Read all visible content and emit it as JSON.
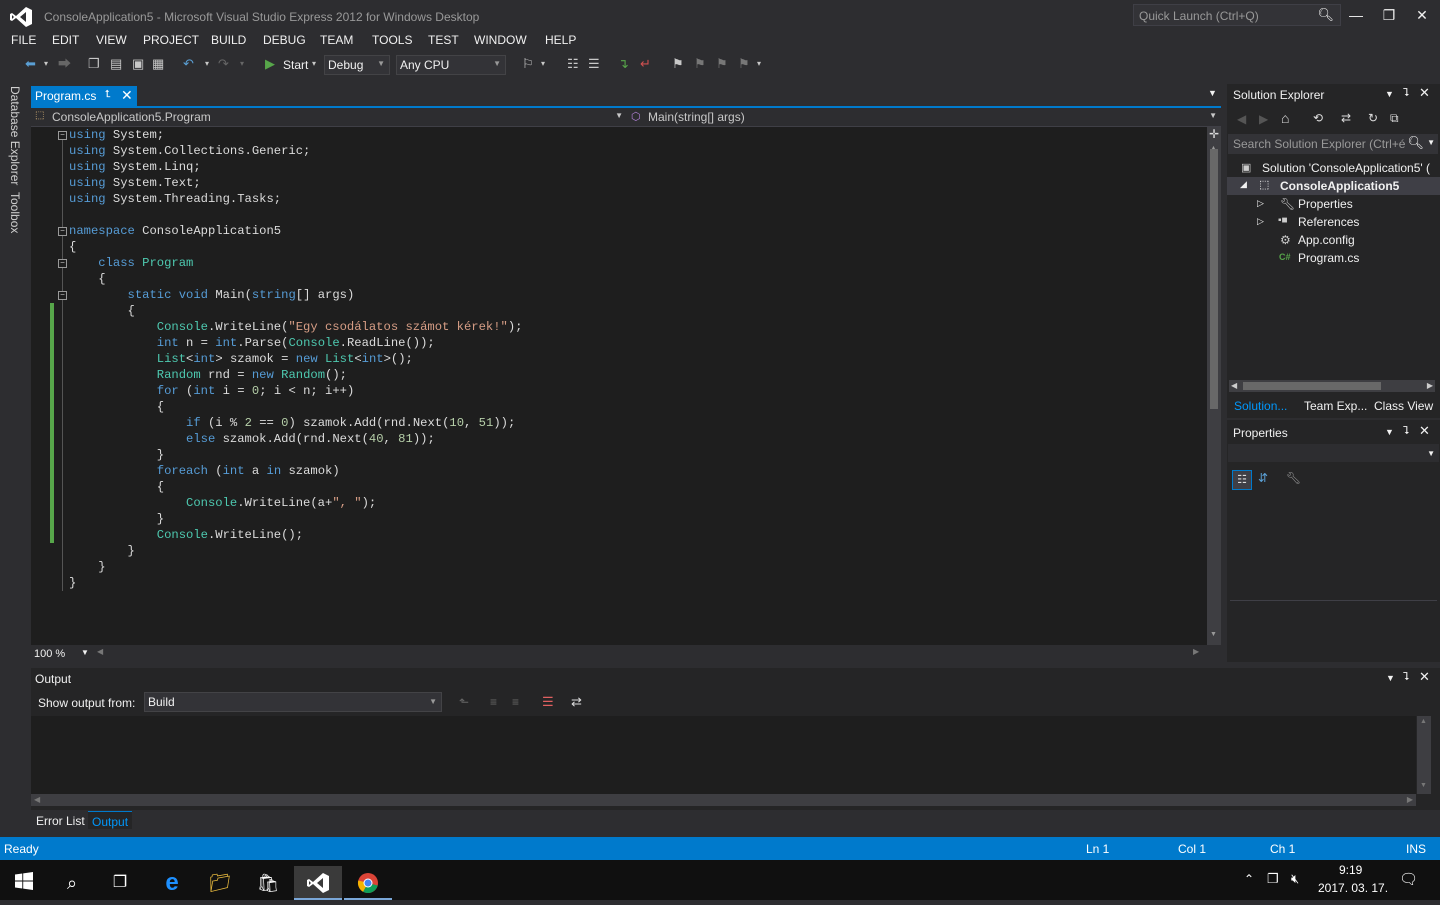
{
  "window": {
    "title": "ConsoleApplication5 - Microsoft Visual Studio Express 2012 for Windows Desktop",
    "quick_launch_placeholder": "Quick Launch (Ctrl+Q)"
  },
  "menu": [
    "FILE",
    "EDIT",
    "VIEW",
    "PROJECT",
    "BUILD",
    "DEBUG",
    "TEAM",
    "TOOLS",
    "TEST",
    "WINDOW",
    "HELP"
  ],
  "toolbar": {
    "start_label": "Start",
    "configuration": "Debug",
    "platform": "Any CPU"
  },
  "left_strip": [
    "Database Explorer",
    "Toolbox"
  ],
  "document": {
    "tab_label": "Program.cs",
    "nav_type": "ConsoleApplication5.Program",
    "nav_member": "Main(string[] args)"
  },
  "code_lines": [
    "using System;",
    "using System.Collections.Generic;",
    "using System.Linq;",
    "using System.Text;",
    "using System.Threading.Tasks;",
    "",
    "namespace ConsoleApplication5",
    "{",
    "    class Program",
    "    {",
    "        static void Main(string[] args)",
    "        {",
    "            Console.WriteLine(\"Egy csodálatos számot kérek!\");",
    "            int n = int.Parse(Console.ReadLine());",
    "            List<int> szamok = new List<int>();",
    "            Random rnd = new Random();",
    "            for (int i = 0; i < n; i++)",
    "            {",
    "                if (i % 2 == 0) szamok.Add(rnd.Next(10, 51));",
    "                else szamok.Add(rnd.Next(40, 81));",
    "            }",
    "            foreach (int a in szamok)",
    "            {",
    "                Console.WriteLine(a+\", \");",
    "            }",
    "            Console.WriteLine();",
    "        }",
    "    }",
    "}"
  ],
  "editor": {
    "zoom": "100 %"
  },
  "solution_explorer": {
    "title": "Solution Explorer",
    "search_placeholder": "Search Solution Explorer (Ctrl+é",
    "solution": "Solution 'ConsoleApplication5' (",
    "project": "ConsoleApplication5",
    "items": [
      "Properties",
      "References",
      "App.config",
      "Program.cs"
    ],
    "tabs": [
      "Solution...",
      "Team Exp...",
      "Class View"
    ]
  },
  "properties": {
    "title": "Properties"
  },
  "output": {
    "title": "Output",
    "show_from_label": "Show output from:",
    "source": "Build"
  },
  "bottom_tabs": [
    "Error List",
    "Output"
  ],
  "status": {
    "state": "Ready",
    "line": "Ln 1",
    "col": "Col 1",
    "ch": "Ch 1",
    "mode": "INS"
  },
  "taskbar": {
    "time": "9:19",
    "date": "2017. 03. 17."
  },
  "colors": {
    "accent": "#007acc",
    "editor_bg": "#1e1e1e",
    "chrome_bg": "#2d2d30",
    "change_bar": "#57a64a"
  }
}
